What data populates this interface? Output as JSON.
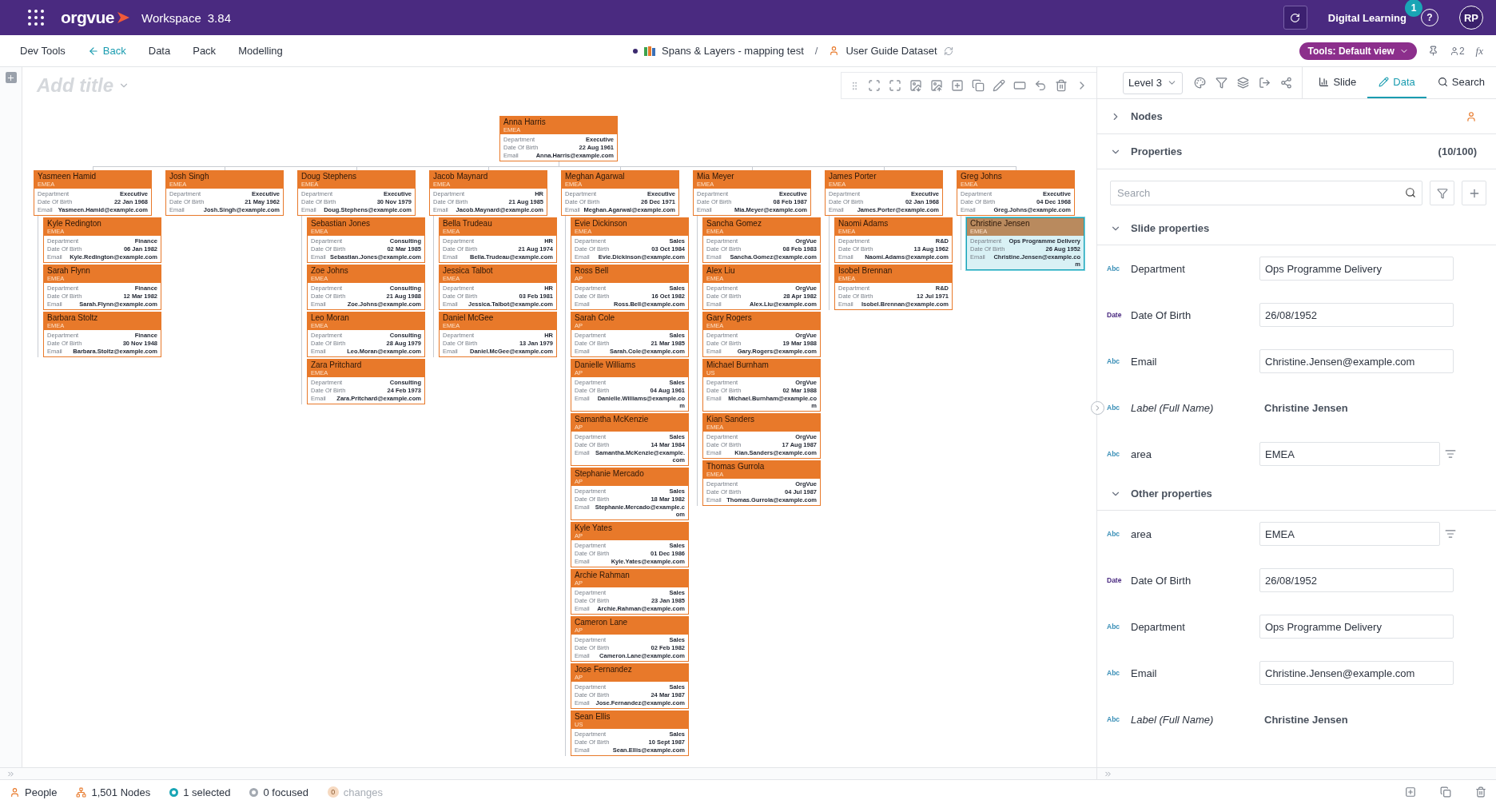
{
  "header": {
    "logo": "orgvue",
    "product": "Workspace",
    "version": "3.84",
    "user_menu": "Digital Learning",
    "notification_count": "1",
    "help": "?",
    "avatar": "RP"
  },
  "nav": {
    "items": [
      {
        "label": "Dev Tools",
        "kind": "link"
      },
      {
        "label": "Back",
        "kind": "back"
      },
      {
        "label": "Data",
        "kind": "link"
      },
      {
        "label": "Pack",
        "kind": "link"
      },
      {
        "label": "Modelling",
        "kind": "link"
      }
    ],
    "breadcrumb": {
      "project": "Spans & Layers - mapping test",
      "separator": "/",
      "dataset": "User Guide Dataset"
    },
    "view_button": "Tools: Default view",
    "collaborators": "2",
    "formula": "fx"
  },
  "canvas": {
    "title_placeholder": "Add title"
  },
  "org_chart": {
    "root": {
      "name": "Anna Harris",
      "area": "EMEA",
      "selected": false,
      "fields": [
        {
          "label": "Department",
          "value": "Executive"
        },
        {
          "label": "Date Of Birth",
          "value": "22 Aug 1961"
        },
        {
          "label": "Email",
          "value": "Anna.Harris@example.com"
        }
      ],
      "children": [
        {
          "name": "Yasmeen Hamid",
          "area": "EMEA",
          "selected": false,
          "fields": [
            {
              "label": "Department",
              "value": "Executive"
            },
            {
              "label": "Date Of Birth",
              "value": "22 Jan 1968"
            },
            {
              "label": "Email",
              "value": "Yasmeen.Hamid@example.com"
            }
          ],
          "children": [
            {
              "name": "Kyle Redington",
              "area": "EMEA",
              "selected": false,
              "fields": [
                {
                  "label": "Department",
                  "value": "Finance"
                },
                {
                  "label": "Date Of Birth",
                  "value": "06 Jan 1982"
                },
                {
                  "label": "Email",
                  "value": "Kyle.Redington@example.com"
                }
              ]
            },
            {
              "name": "Sarah Flynn",
              "area": "EMEA",
              "selected": false,
              "fields": [
                {
                  "label": "Department",
                  "value": "Finance"
                },
                {
                  "label": "Date Of Birth",
                  "value": "12 Mar 1982"
                },
                {
                  "label": "Email",
                  "value": "Sarah.Flynn@example.com"
                }
              ]
            },
            {
              "name": "Barbara Stoltz",
              "area": "EMEA",
              "selected": false,
              "fields": [
                {
                  "label": "Department",
                  "value": "Finance"
                },
                {
                  "label": "Date Of Birth",
                  "value": "30 Nov 1948"
                },
                {
                  "label": "Email",
                  "value": "Barbara.Stoltz@example.com"
                }
              ]
            }
          ]
        },
        {
          "name": "Josh Singh",
          "area": "EMEA",
          "selected": false,
          "fields": [
            {
              "label": "Department",
              "value": "Executive"
            },
            {
              "label": "Date Of Birth",
              "value": "21 May 1962"
            },
            {
              "label": "Email",
              "value": "Josh.Singh@example.com"
            }
          ]
        },
        {
          "name": "Doug Stephens",
          "area": "EMEA",
          "selected": false,
          "fields": [
            {
              "label": "Department",
              "value": "Executive"
            },
            {
              "label": "Date Of Birth",
              "value": "30 Nov 1979"
            },
            {
              "label": "Email",
              "value": "Doug.Stephens@example.com"
            }
          ],
          "children": [
            {
              "name": "Sebastian Jones",
              "area": "EMEA",
              "selected": false,
              "fields": [
                {
                  "label": "Department",
                  "value": "Consulting"
                },
                {
                  "label": "Date Of Birth",
                  "value": "02 Mar 1985"
                },
                {
                  "label": "Email",
                  "value": "Sebastian.Jones@example.com"
                }
              ]
            },
            {
              "name": "Zoe Johns",
              "area": "EMEA",
              "selected": false,
              "fields": [
                {
                  "label": "Department",
                  "value": "Consulting"
                },
                {
                  "label": "Date Of Birth",
                  "value": "21 Aug 1988"
                },
                {
                  "label": "Email",
                  "value": "Zoe.Johns@example.com"
                }
              ]
            },
            {
              "name": "Leo Moran",
              "area": "EMEA",
              "selected": false,
              "fields": [
                {
                  "label": "Department",
                  "value": "Consulting"
                },
                {
                  "label": "Date Of Birth",
                  "value": "28 Aug 1979"
                },
                {
                  "label": "Email",
                  "value": "Leo.Moran@example.com"
                }
              ]
            },
            {
              "name": "Zara Pritchard",
              "area": "EMEA",
              "selected": false,
              "fields": [
                {
                  "label": "Department",
                  "value": "Consulting"
                },
                {
                  "label": "Date Of Birth",
                  "value": "24 Feb 1973"
                },
                {
                  "label": "Email",
                  "value": "Zara.Pritchard@example.com"
                }
              ]
            }
          ]
        },
        {
          "name": "Jacob Maynard",
          "area": "EMEA",
          "selected": false,
          "fields": [
            {
              "label": "Department",
              "value": "HR"
            },
            {
              "label": "Date Of Birth",
              "value": "21 Aug 1985"
            },
            {
              "label": "Email",
              "value": "Jacob.Maynard@example.com"
            }
          ],
          "children": [
            {
              "name": "Bella Trudeau",
              "area": "EMEA",
              "selected": false,
              "fields": [
                {
                  "label": "Department",
                  "value": "HR"
                },
                {
                  "label": "Date Of Birth",
                  "value": "21 Aug 1974"
                },
                {
                  "label": "Email",
                  "value": "Bella.Trudeau@example.com"
                }
              ]
            },
            {
              "name": "Jessica Talbot",
              "area": "EMEA",
              "selected": false,
              "fields": [
                {
                  "label": "Department",
                  "value": "HR"
                },
                {
                  "label": "Date Of Birth",
                  "value": "03 Feb 1981"
                },
                {
                  "label": "Email",
                  "value": "Jessica.Talbot@example.com"
                }
              ]
            },
            {
              "name": "Daniel McGee",
              "area": "EMEA",
              "selected": false,
              "fields": [
                {
                  "label": "Department",
                  "value": "HR"
                },
                {
                  "label": "Date Of Birth",
                  "value": "13 Jan 1979"
                },
                {
                  "label": "Email",
                  "value": "Daniel.McGee@example.com"
                }
              ]
            }
          ]
        },
        {
          "name": "Meghan Agarwal",
          "area": "EMEA",
          "selected": false,
          "fields": [
            {
              "label": "Department",
              "value": "Executive"
            },
            {
              "label": "Date Of Birth",
              "value": "26 Dec 1971"
            },
            {
              "label": "Email",
              "value": "Meghan.Agarwal@example.com"
            }
          ],
          "children": [
            {
              "name": "Evie Dickinson",
              "area": "EMEA",
              "selected": false,
              "fields": [
                {
                  "label": "Department",
                  "value": "Sales"
                },
                {
                  "label": "Date Of Birth",
                  "value": "03 Oct 1984"
                },
                {
                  "label": "Email",
                  "value": "Evie.Dickinson@example.com"
                }
              ]
            },
            {
              "name": "Ross Bell",
              "area": "AP",
              "selected": false,
              "fields": [
                {
                  "label": "Department",
                  "value": "Sales"
                },
                {
                  "label": "Date Of Birth",
                  "value": "16 Oct 1982"
                },
                {
                  "label": "Email",
                  "value": "Ross.Bell@example.com"
                }
              ]
            },
            {
              "name": "Sarah Cole",
              "area": "AP",
              "selected": false,
              "fields": [
                {
                  "label": "Department",
                  "value": "Sales"
                },
                {
                  "label": "Date Of Birth",
                  "value": "21 Mar 1985"
                },
                {
                  "label": "Email",
                  "value": "Sarah.Cole@example.com"
                }
              ]
            },
            {
              "name": "Danielle Williams",
              "area": "AP",
              "selected": false,
              "fields": [
                {
                  "label": "Department",
                  "value": "Sales"
                },
                {
                  "label": "Date Of Birth",
                  "value": "04 Aug 1961"
                },
                {
                  "label": "Email",
                  "value": "Danielle.Williams@example.com"
                }
              ]
            },
            {
              "name": "Samantha McKenzie",
              "area": "AP",
              "selected": false,
              "fields": [
                {
                  "label": "Department",
                  "value": "Sales"
                },
                {
                  "label": "Date Of Birth",
                  "value": "14 Mar 1984"
                },
                {
                  "label": "Email",
                  "value": "Samantha.McKenzie@example.com"
                }
              ]
            },
            {
              "name": "Stephanie Mercado",
              "area": "AP",
              "selected": false,
              "fields": [
                {
                  "label": "Department",
                  "value": "Sales"
                },
                {
                  "label": "Date Of Birth",
                  "value": "18 Mar 1982"
                },
                {
                  "label": "Email",
                  "value": "Stephanie.Mercado@example.com"
                }
              ]
            },
            {
              "name": "Kyle Yates",
              "area": "AP",
              "selected": false,
              "fields": [
                {
                  "label": "Department",
                  "value": "Sales"
                },
                {
                  "label": "Date Of Birth",
                  "value": "01 Dec 1986"
                },
                {
                  "label": "Email",
                  "value": "Kyle.Yates@example.com"
                }
              ]
            },
            {
              "name": "Archie Rahman",
              "area": "AP",
              "selected": false,
              "fields": [
                {
                  "label": "Department",
                  "value": "Sales"
                },
                {
                  "label": "Date Of Birth",
                  "value": "23 Jan 1985"
                },
                {
                  "label": "Email",
                  "value": "Archie.Rahman@example.com"
                }
              ]
            },
            {
              "name": "Cameron Lane",
              "area": "AP",
              "selected": false,
              "fields": [
                {
                  "label": "Department",
                  "value": "Sales"
                },
                {
                  "label": "Date Of Birth",
                  "value": "02 Feb 1982"
                },
                {
                  "label": "Email",
                  "value": "Cameron.Lane@example.com"
                }
              ]
            },
            {
              "name": "Jose Fernandez",
              "area": "AP",
              "selected": false,
              "fields": [
                {
                  "label": "Department",
                  "value": "Sales"
                },
                {
                  "label": "Date Of Birth",
                  "value": "24 Mar 1987"
                },
                {
                  "label": "Email",
                  "value": "Jose.Fernandez@example.com"
                }
              ]
            },
            {
              "name": "Sean Ellis",
              "area": "US",
              "selected": false,
              "fields": [
                {
                  "label": "Department",
                  "value": "Sales"
                },
                {
                  "label": "Date Of Birth",
                  "value": "10 Sept 1987"
                },
                {
                  "label": "Email",
                  "value": "Sean.Ellis@example.com"
                }
              ]
            }
          ]
        },
        {
          "name": "Mia Meyer",
          "area": "EMEA",
          "selected": false,
          "fields": [
            {
              "label": "Department",
              "value": "Executive"
            },
            {
              "label": "Date Of Birth",
              "value": "08 Feb 1987"
            },
            {
              "label": "Email",
              "value": "Mia.Meyer@example.com"
            }
          ],
          "children": [
            {
              "name": "Sancha Gomez",
              "area": "EMEA",
              "selected": false,
              "fields": [
                {
                  "label": "Department",
                  "value": "OrgVue"
                },
                {
                  "label": "Date Of Birth",
                  "value": "08 Feb 1983"
                },
                {
                  "label": "Email",
                  "value": "Sancha.Gomez@example.com"
                }
              ]
            },
            {
              "name": "Alex Liu",
              "area": "EMEA",
              "selected": false,
              "fields": [
                {
                  "label": "Department",
                  "value": "OrgVue"
                },
                {
                  "label": "Date Of Birth",
                  "value": "28 Apr 1982"
                },
                {
                  "label": "Email",
                  "value": "Alex.Liu@example.com"
                }
              ]
            },
            {
              "name": "Gary Rogers",
              "area": "EMEA",
              "selected": false,
              "fields": [
                {
                  "label": "Department",
                  "value": "OrgVue"
                },
                {
                  "label": "Date Of Birth",
                  "value": "19 Mar 1988"
                },
                {
                  "label": "Email",
                  "value": "Gary.Rogers@example.com"
                }
              ]
            },
            {
              "name": "Michael Burnham",
              "area": "US",
              "selected": false,
              "fields": [
                {
                  "label": "Department",
                  "value": "OrgVue"
                },
                {
                  "label": "Date Of Birth",
                  "value": "02 Mar 1988"
                },
                {
                  "label": "Email",
                  "value": "Michael.Burnham@example.com"
                }
              ]
            },
            {
              "name": "Kian Sanders",
              "area": "EMEA",
              "selected": false,
              "fields": [
                {
                  "label": "Department",
                  "value": "OrgVue"
                },
                {
                  "label": "Date Of Birth",
                  "value": "17 Aug 1987"
                },
                {
                  "label": "Email",
                  "value": "Kian.Sanders@example.com"
                }
              ]
            },
            {
              "name": "Thomas Gurrola",
              "area": "EMEA",
              "selected": false,
              "fields": [
                {
                  "label": "Department",
                  "value": "OrgVue"
                },
                {
                  "label": "Date Of Birth",
                  "value": "04 Jul 1987"
                },
                {
                  "label": "Email",
                  "value": "Thomas.Gurrola@example.com"
                }
              ]
            }
          ]
        },
        {
          "name": "James Porter",
          "area": "EMEA",
          "selected": false,
          "fields": [
            {
              "label": "Department",
              "value": "Executive"
            },
            {
              "label": "Date Of Birth",
              "value": "02 Jan 1968"
            },
            {
              "label": "Email",
              "value": "James.Porter@example.com"
            }
          ],
          "children": [
            {
              "name": "Naomi Adams",
              "area": "EMEA",
              "selected": false,
              "fields": [
                {
                  "label": "Department",
                  "value": "R&D"
                },
                {
                  "label": "Date Of Birth",
                  "value": "13 Aug 1962"
                },
                {
                  "label": "Email",
                  "value": "Naomi.Adams@example.com"
                }
              ]
            },
            {
              "name": "Isobel Brennan",
              "area": "EMEA",
              "selected": false,
              "fields": [
                {
                  "label": "Department",
                  "value": "R&D"
                },
                {
                  "label": "Date Of Birth",
                  "value": "12 Jul 1971"
                },
                {
                  "label": "Email",
                  "value": "Isobel.Brennan@example.com"
                }
              ]
            }
          ]
        },
        {
          "name": "Greg Johns",
          "area": "EMEA",
          "selected": false,
          "fields": [
            {
              "label": "Department",
              "value": "Executive"
            },
            {
              "label": "Date Of Birth",
              "value": "04 Dec 1968"
            },
            {
              "label": "Email",
              "value": "Greg.Johns@example.com"
            }
          ],
          "children": [
            {
              "name": "Christine Jensen",
              "area": "EMEA",
              "selected": true,
              "fields": [
                {
                  "label": "Department",
                  "value": "Ops Programme Delivery"
                },
                {
                  "label": "Date Of Birth",
                  "value": "26 Aug 1952"
                },
                {
                  "label": "Email",
                  "value": "Christine.Jensen@example.com"
                }
              ]
            }
          ]
        }
      ]
    }
  },
  "panel": {
    "level_select": "Level 3",
    "tabs": [
      {
        "label": "Slide",
        "selected": false
      },
      {
        "label": "Data",
        "selected": true
      },
      {
        "label": "Search",
        "selected": false
      }
    ],
    "nodes_section": {
      "title": "Nodes",
      "expanded": false
    },
    "properties_section": {
      "title": "Properties",
      "count": "(10/100)",
      "expanded": true,
      "search_placeholder": "Search"
    },
    "groups": [
      {
        "title": "Slide properties",
        "expanded": true,
        "rows": [
          {
            "type": "Abc",
            "label": "Department",
            "value": "Ops Programme Delivery",
            "kind": "input"
          },
          {
            "type": "Date",
            "label": "Date Of Birth",
            "value": "26/08/1952",
            "kind": "input"
          },
          {
            "type": "Abc",
            "label": "Email",
            "value": "Christine.Jensen@example.com",
            "kind": "input"
          },
          {
            "type": "Abc",
            "label": "Label (Full Name)",
            "value": "Christine Jensen",
            "kind": "text"
          },
          {
            "type": "Abc",
            "label": "area",
            "value": "EMEA",
            "kind": "mapped"
          }
        ]
      },
      {
        "title": "Other properties",
        "expanded": true,
        "rows": [
          {
            "type": "Abc",
            "label": "area",
            "value": "EMEA",
            "kind": "mapped"
          },
          {
            "type": "Date",
            "label": "Date Of Birth",
            "value": "26/08/1952",
            "kind": "input"
          },
          {
            "type": "Abc",
            "label": "Department",
            "value": "Ops Programme Delivery",
            "kind": "input"
          },
          {
            "type": "Abc",
            "label": "Email",
            "value": "Christine.Jensen@example.com",
            "kind": "input"
          },
          {
            "type": "Abc",
            "label": "Label (Full Name)",
            "value": "Christine Jensen",
            "kind": "text"
          }
        ]
      }
    ]
  },
  "status_bar": [
    {
      "kind": "dataset",
      "text": "People",
      "disabled": false
    },
    {
      "kind": "nodes",
      "text": "1,501 Nodes",
      "disabled": false
    },
    {
      "kind": "selected",
      "text": "1 selected",
      "disabled": false
    },
    {
      "kind": "focused",
      "text": "0 focused",
      "disabled": false
    },
    {
      "kind": "changes",
      "count": "0",
      "text": "changes",
      "disabled": true
    }
  ]
}
